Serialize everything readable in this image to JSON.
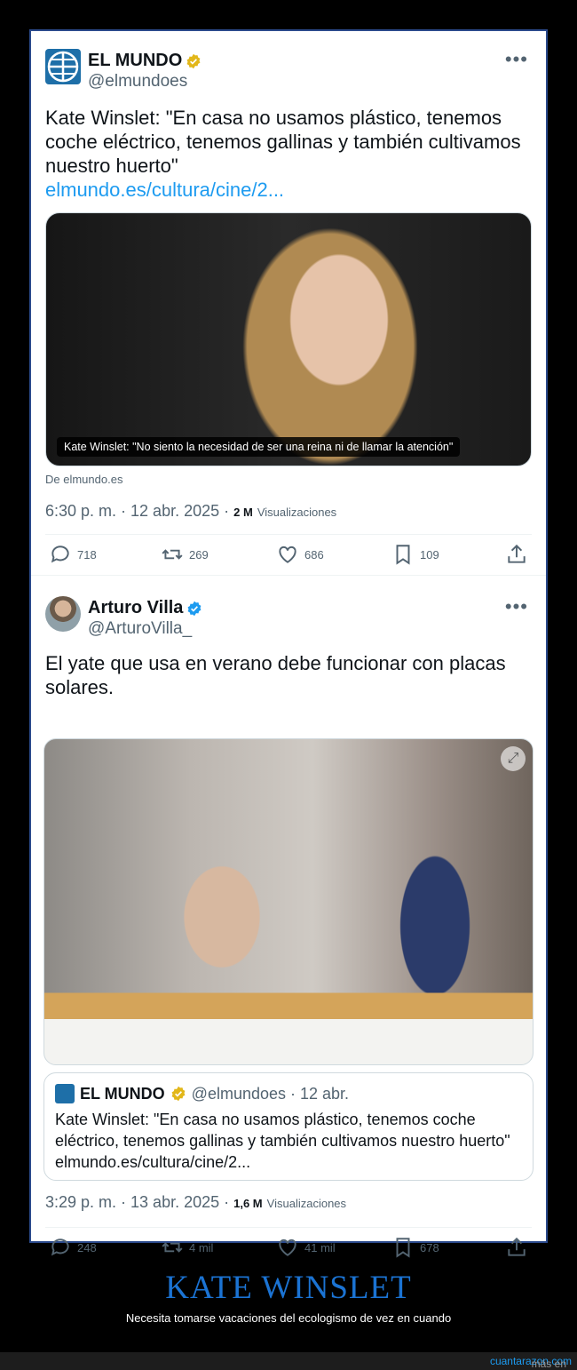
{
  "tweet1": {
    "author_name": "EL MUNDO",
    "author_handle": "@elmundoes",
    "avatar_icon": "globe-grid-logo-icon",
    "verified_color": "#e2b719",
    "text": "Kate Winslet: \"En casa no usamos plástico, tenemos coche eléctrico, tenemos gallinas y también cultivamos nuestro huerto\"",
    "link": "elmundo.es/cultura/cine/2...",
    "image_caption": "Kate Winslet: \"No siento la necesidad de ser una reina ni de llamar la atención\"",
    "source": "De elmundo.es",
    "timestamp": "6:30 p. m. · 12 abr. 2025 · ",
    "views_count": "2 M",
    "views_label": "Visualizaciones",
    "replies": "718",
    "reposts": "269",
    "likes": "686",
    "bookmarks": "109"
  },
  "tweet2": {
    "author_name": "Arturo Villa",
    "author_handle": "@ArturoVilla_",
    "verified_color": "#1d9bf0",
    "text": "El yate que usa en verano debe funcionar con placas solares.",
    "quote": {
      "name": "EL MUNDO",
      "handle": "@elmundoes · 12 abr.",
      "text": "Kate Winslet: \"En casa no usamos plástico, tenemos coche eléctrico, tenemos gallinas y también cultivamos nuestro huerto\" elmundo.es/cultura/cine/2..."
    },
    "timestamp": "3:29 p. m. · 13 abr. 2025 · ",
    "views_count": "1,6 M",
    "views_label": "Visualizaciones",
    "replies": "248",
    "reposts": "4 mil",
    "likes": "41 mil",
    "bookmarks": "678"
  },
  "footer": {
    "title": "KATE WINSLET",
    "subtitle": "Necesita tomarse vacaciones del ecologismo de vez en cuando",
    "more_prefix": "más en",
    "site": "cuantarazon.com",
    "title_color": "#1b73d3"
  }
}
